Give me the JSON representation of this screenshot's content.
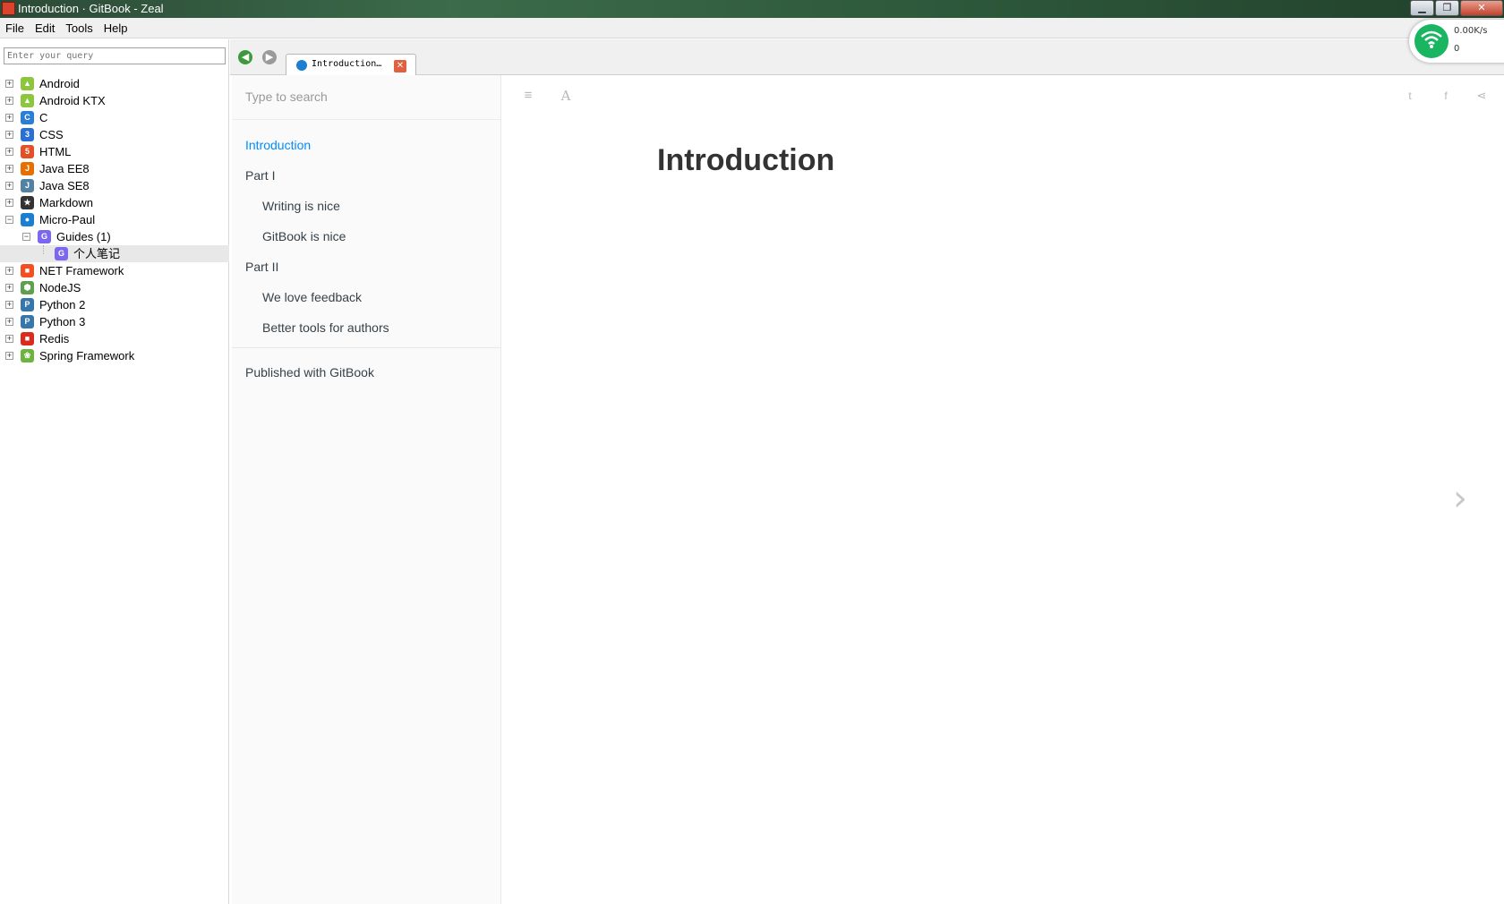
{
  "window": {
    "title": "Introduction · GitBook - Zeal",
    "minimize_label": "▁",
    "restore_label": "❐",
    "close_label": "✕"
  },
  "menu": [
    {
      "label": "File"
    },
    {
      "label": "Edit"
    },
    {
      "label": "Tools"
    },
    {
      "label": "Help"
    }
  ],
  "network_widget": {
    "speed": "0.00K/s",
    "count": "0",
    "color": "#19b561"
  },
  "search": {
    "placeholder": "Enter your query"
  },
  "doc_tree": [
    {
      "label": "Android",
      "icon": "android-icon",
      "color": "#8cc63f"
    },
    {
      "label": "Android KTX",
      "icon": "android-icon",
      "color": "#8cc63f"
    },
    {
      "label": "C",
      "icon": "c-icon",
      "color": "#2a7fd4"
    },
    {
      "label": "CSS",
      "icon": "css-icon",
      "color": "#2a6fd4"
    },
    {
      "label": "HTML",
      "icon": "html-icon",
      "color": "#e34f26"
    },
    {
      "label": "Java EE8",
      "icon": "java-icon",
      "color": "#e76f00"
    },
    {
      "label": "Java SE8",
      "icon": "java-icon",
      "color": "#5382a1"
    },
    {
      "label": "Markdown",
      "icon": "markdown-icon",
      "color": "#333333"
    },
    {
      "label": "Micro-Paul",
      "icon": "gitbook-icon",
      "color": "#1a7fd0"
    },
    {
      "label": "Guides (1)",
      "icon": "guides-icon",
      "color": "#7b68ee"
    },
    {
      "label": "个人笔记",
      "icon": "guide-page-icon",
      "color": "#7b68ee"
    },
    {
      "label": "NET Framework",
      "icon": "windows-icon",
      "color": "#f25022"
    },
    {
      "label": "NodeJS",
      "icon": "nodejs-icon",
      "color": "#5fa04e"
    },
    {
      "label": "Python 2",
      "icon": "python-icon",
      "color": "#3776ab"
    },
    {
      "label": "Python 3",
      "icon": "python-icon",
      "color": "#3776ab"
    },
    {
      "label": "Redis",
      "icon": "redis-icon",
      "color": "#d82c20"
    },
    {
      "label": "Spring Framework",
      "icon": "spring-icon",
      "color": "#6db33f"
    }
  ],
  "tab": {
    "label": "Introduction…",
    "close_label": "✕"
  },
  "book": {
    "search_placeholder": "Type to search",
    "summary": [
      {
        "label": "Introduction",
        "active": true
      },
      {
        "label": "Part I"
      },
      {
        "label": "Writing is nice"
      },
      {
        "label": "GitBook is nice"
      },
      {
        "label": "Part II"
      },
      {
        "label": "We love feedback"
      },
      {
        "label": "Better tools for authors"
      }
    ],
    "published": "Published with GitBook",
    "accent": "#008cff"
  },
  "content": {
    "title": "Introduction",
    "next_arrow": "›"
  }
}
